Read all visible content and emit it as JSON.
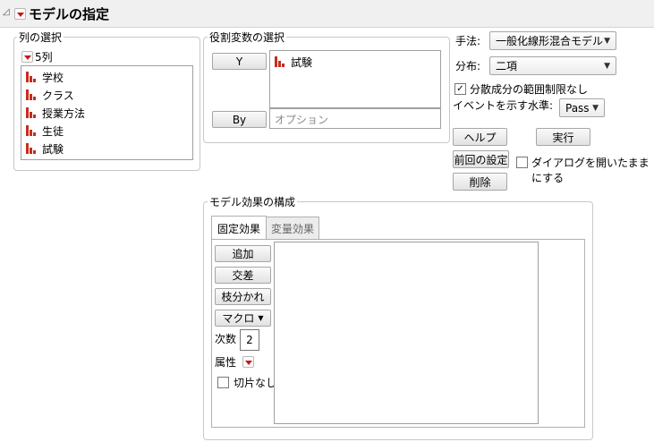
{
  "header": {
    "title": "モデルの指定"
  },
  "columns": {
    "group_label": "列の選択",
    "count_label": "5列",
    "items": [
      {
        "label": "学校"
      },
      {
        "label": "クラス"
      },
      {
        "label": "授業方法"
      },
      {
        "label": "生徒"
      },
      {
        "label": "試験"
      }
    ]
  },
  "roles": {
    "group_label": "役割変数の選択",
    "y_button": "Y",
    "y_items": [
      {
        "label": "試験"
      }
    ],
    "by_button": "By",
    "by_placeholder": "オプション"
  },
  "options": {
    "method_label": "手法:",
    "method_value": "一般化線形混合モデル",
    "dist_label": "分布:",
    "dist_value": "二項",
    "variance_checkbox_label": "分散成分の範囲制限なし",
    "variance_checked": true,
    "event_label": "イベントを示す水準:",
    "event_value": "Pass"
  },
  "actions": {
    "help": "ヘルプ",
    "run": "実行",
    "recall": "前回の設定",
    "keep_open_label": "ダイアログを開いたままにする",
    "keep_open_checked": false,
    "remove": "削除"
  },
  "effects": {
    "group_label": "モデル効果の構成",
    "tabs": [
      {
        "label": "固定効果",
        "active": true
      },
      {
        "label": "変量効果",
        "active": false
      }
    ],
    "add": "追加",
    "cross": "交差",
    "nest": "枝分かれ",
    "macros": "マクロ",
    "degree_label": "次数",
    "degree_value": "2",
    "attributes_label": "属性",
    "no_intercept_label": "切片なし",
    "no_intercept_checked": false
  },
  "icons": {
    "column_type_icon": "nominal-bar-icon",
    "menu_icon": "red-triangle-menu-icon",
    "disclosure_icon": "disclosure-triangle-icon"
  },
  "colors": {
    "icon_red": "#c62d1f",
    "menu_triangle": "#d01414"
  }
}
